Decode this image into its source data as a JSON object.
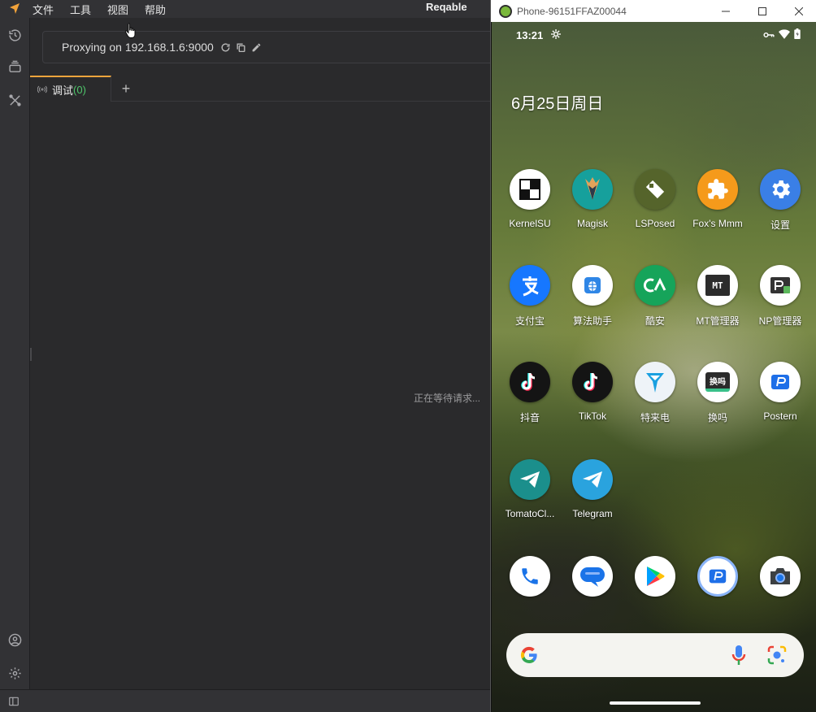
{
  "reqable": {
    "menu": [
      "文件",
      "工具",
      "视图",
      "帮助"
    ],
    "app_title": "Reqable",
    "proxy_text": "Proxying on 192.168.1.6:9000",
    "tab": {
      "label": "调试",
      "count": "(0)"
    },
    "add_tab": "+",
    "empty_text": "正在等待请求..."
  },
  "phone_window": {
    "title": "Phone-96151FFAZ00044"
  },
  "phone": {
    "time": "13:21",
    "date": "6月25日周日",
    "apps": [
      {
        "label": "KernelSU"
      },
      {
        "label": "Magisk"
      },
      {
        "label": "LSPosed"
      },
      {
        "label": "Fox's Mmm"
      },
      {
        "label": "设置"
      },
      {
        "label": "支付宝"
      },
      {
        "label": "算法助手"
      },
      {
        "label": "酷安"
      },
      {
        "label": "MT管理器"
      },
      {
        "label": "NP管理器"
      },
      {
        "label": "抖音"
      },
      {
        "label": "TikTok"
      },
      {
        "label": "特来电"
      },
      {
        "label": "换吗"
      },
      {
        "label": "Postern"
      },
      {
        "label": "TomatoCl..."
      },
      {
        "label": "Telegram"
      }
    ],
    "icon_text": {
      "mt": "MT",
      "huanma": "换吗"
    }
  },
  "colors": {
    "accent": "#f1a43c",
    "count_green": "#4fc66b"
  }
}
